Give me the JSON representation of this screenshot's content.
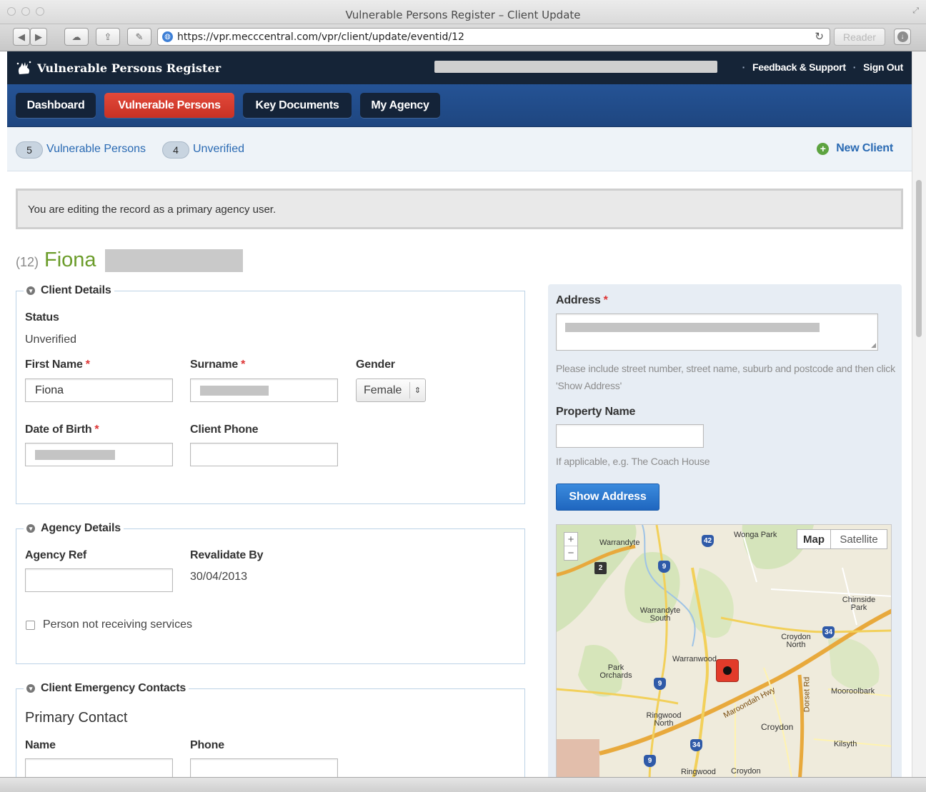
{
  "window": {
    "title": "Vulnerable Persons Register – Client Update"
  },
  "browser": {
    "url": "https://vpr.mecccentral.com/vpr/client/update/eventid/12",
    "reader_label": "Reader"
  },
  "header": {
    "app_name": "Vulnerable Persons Register",
    "links": [
      {
        "label": "Feedback & Support"
      },
      {
        "label": "Sign Out"
      }
    ]
  },
  "nav": {
    "tabs": [
      {
        "label": "Dashboard",
        "active": false
      },
      {
        "label": "Vulnerable Persons",
        "active": true
      },
      {
        "label": "Key Documents",
        "active": false
      },
      {
        "label": "My Agency",
        "active": false
      }
    ]
  },
  "subnav": {
    "counts": [
      {
        "count": "5",
        "label": "Vulnerable Persons"
      },
      {
        "count": "4",
        "label": "Unverified"
      }
    ],
    "new_client_label": "New Client"
  },
  "notice": "You are editing the record as a primary agency user.",
  "client": {
    "id_label": "(12)",
    "first_name": "Fiona"
  },
  "client_details": {
    "legend": "Client Details",
    "status_label": "Status",
    "status_value": "Unverified",
    "first_name_label": "First Name",
    "first_name_value": "Fiona",
    "surname_label": "Surname",
    "gender_label": "Gender",
    "gender_value": "Female",
    "dob_label": "Date of Birth",
    "phone_label": "Client Phone",
    "required_mark": "*"
  },
  "agency_details": {
    "legend": "Agency Details",
    "agency_ref_label": "Agency Ref",
    "revalidate_label": "Revalidate By",
    "revalidate_value": "30/04/2013",
    "not_receiving_label": "Person not receiving services"
  },
  "emergency_contacts": {
    "legend": "Client Emergency Contacts",
    "primary_heading": "Primary Contact",
    "name_label": "Name",
    "phone_label": "Phone"
  },
  "address_panel": {
    "address_label": "Address",
    "address_help": "Please include street number, street name, suburb and postcode and then click 'Show Address'",
    "property_label": "Property Name",
    "property_help": "If applicable, e.g. The Coach House",
    "show_address_label": "Show Address"
  },
  "map": {
    "type_buttons": [
      "Map",
      "Satellite"
    ],
    "zoom_in": "+",
    "zoom_out": "−",
    "places": [
      "Warrandyte",
      "Wonga Park",
      "Chirnside Park",
      "Warrandyte South",
      "Croydon North",
      "Warranwood",
      "Park Orchards",
      "Mooroolbark",
      "Ringwood North",
      "Croydon",
      "Kilsyth",
      "Ringwood",
      "Croydon"
    ],
    "road_labels": [
      "Maroondah Hwy",
      "Dorset Rd"
    ],
    "route_shields": [
      "42",
      "9",
      "2",
      "34",
      "9",
      "34",
      "9"
    ]
  }
}
